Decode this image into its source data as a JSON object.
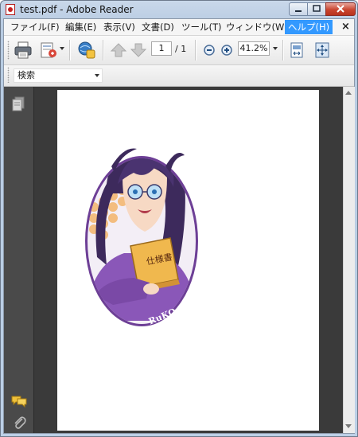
{
  "window": {
    "title": "test.pdf - Adobe Reader"
  },
  "menu": {
    "items": [
      "ファイル(F)",
      "編集(E)",
      "表示(V)",
      "文書(D)",
      "ツール(T)",
      "ウィンドウ(W)",
      "ヘルプ(H)"
    ],
    "active_index": 6,
    "close_glyph": "×"
  },
  "toolbar": {
    "current_page": "1",
    "page_total": "/ 1",
    "zoom": "41.2%"
  },
  "search": {
    "placeholder": "検索"
  },
  "document": {
    "illustration_signature": "RuKO.C",
    "book_title": "仕様書"
  },
  "icons": {
    "app": "pdf-icon",
    "print": "printer-icon",
    "share": "share-icon",
    "collab": "collaborate-icon",
    "prev": "arrow-up-icon",
    "next": "arrow-down-icon",
    "zoom_out": "zoom-out-icon",
    "zoom_in": "zoom-in-icon",
    "fit_page": "fit-page-icon",
    "fit_width": "fit-width-icon",
    "pages": "pages-icon",
    "comments": "comment-icon",
    "attachments": "paperclip-icon"
  },
  "colors": {
    "menu_active": "#3399ff",
    "close_button": "#c9452f",
    "nav_pane": "#4a4a4a",
    "workspace": "#3a3a3a"
  }
}
